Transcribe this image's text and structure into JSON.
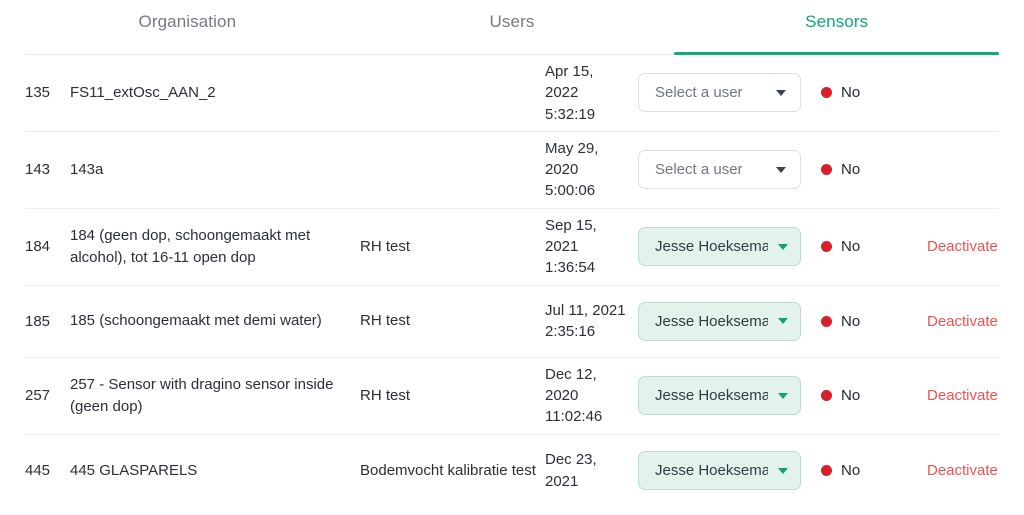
{
  "tabs": [
    {
      "label": "Organisation",
      "active": false
    },
    {
      "label": "Users",
      "active": false
    },
    {
      "label": "Sensors",
      "active": true
    }
  ],
  "colors": {
    "accent_green": "#0fa97e",
    "tab_inactive": "#737a85",
    "status_red_dot": "#d81f2a",
    "deactivate_red": "#ef5350",
    "assigned_bg": "#e4f2ec",
    "assigned_border": "#b9ddcd",
    "row_divider": "#ededef"
  },
  "select_placeholder": "Select a user",
  "status_no_label": "No",
  "deactivate_label": "Deactivate",
  "rows": [
    {
      "id": "135",
      "name": "FS11_extOsc_AAN_2",
      "organisation": "",
      "date": "Apr 15, 2022 5:32:19",
      "user": "Select a user",
      "user_assigned": false,
      "status": "No",
      "action": ""
    },
    {
      "id": "143",
      "name": "143a",
      "organisation": "",
      "date": "May 29, 2020 5:00:06",
      "user": "Select a user",
      "user_assigned": false,
      "status": "No",
      "action": ""
    },
    {
      "id": "184",
      "name": "184 (geen dop, schoongemaakt met alcohol), tot 16-11 open dop",
      "organisation": "RH test",
      "date": "Sep 15, 2021 1:36:54",
      "user": "Jesse Hoeksema",
      "user_assigned": true,
      "status": "No",
      "action": "Deactivate"
    },
    {
      "id": "185",
      "name": "185 (schoongemaakt met demi water)",
      "organisation": "RH test",
      "date": "Jul 11, 2021 2:35:16",
      "user": "Jesse Hoeksema",
      "user_assigned": true,
      "status": "No",
      "action": "Deactivate"
    },
    {
      "id": "257",
      "name": "257 - Sensor with dragino sensor inside (geen dop)",
      "organisation": "RH test",
      "date": "Dec 12, 2020 11:02:46",
      "user": "Jesse Hoeksema",
      "user_assigned": true,
      "status": "No",
      "action": "Deactivate"
    },
    {
      "id": "445",
      "name": "445 GLASPARELS",
      "organisation": "Bodemvocht kalibratie test",
      "date": "Dec 23, 2021",
      "user": "Jesse Hoeksema",
      "user_assigned": true,
      "status": "No",
      "action": "Deactivate"
    }
  ]
}
